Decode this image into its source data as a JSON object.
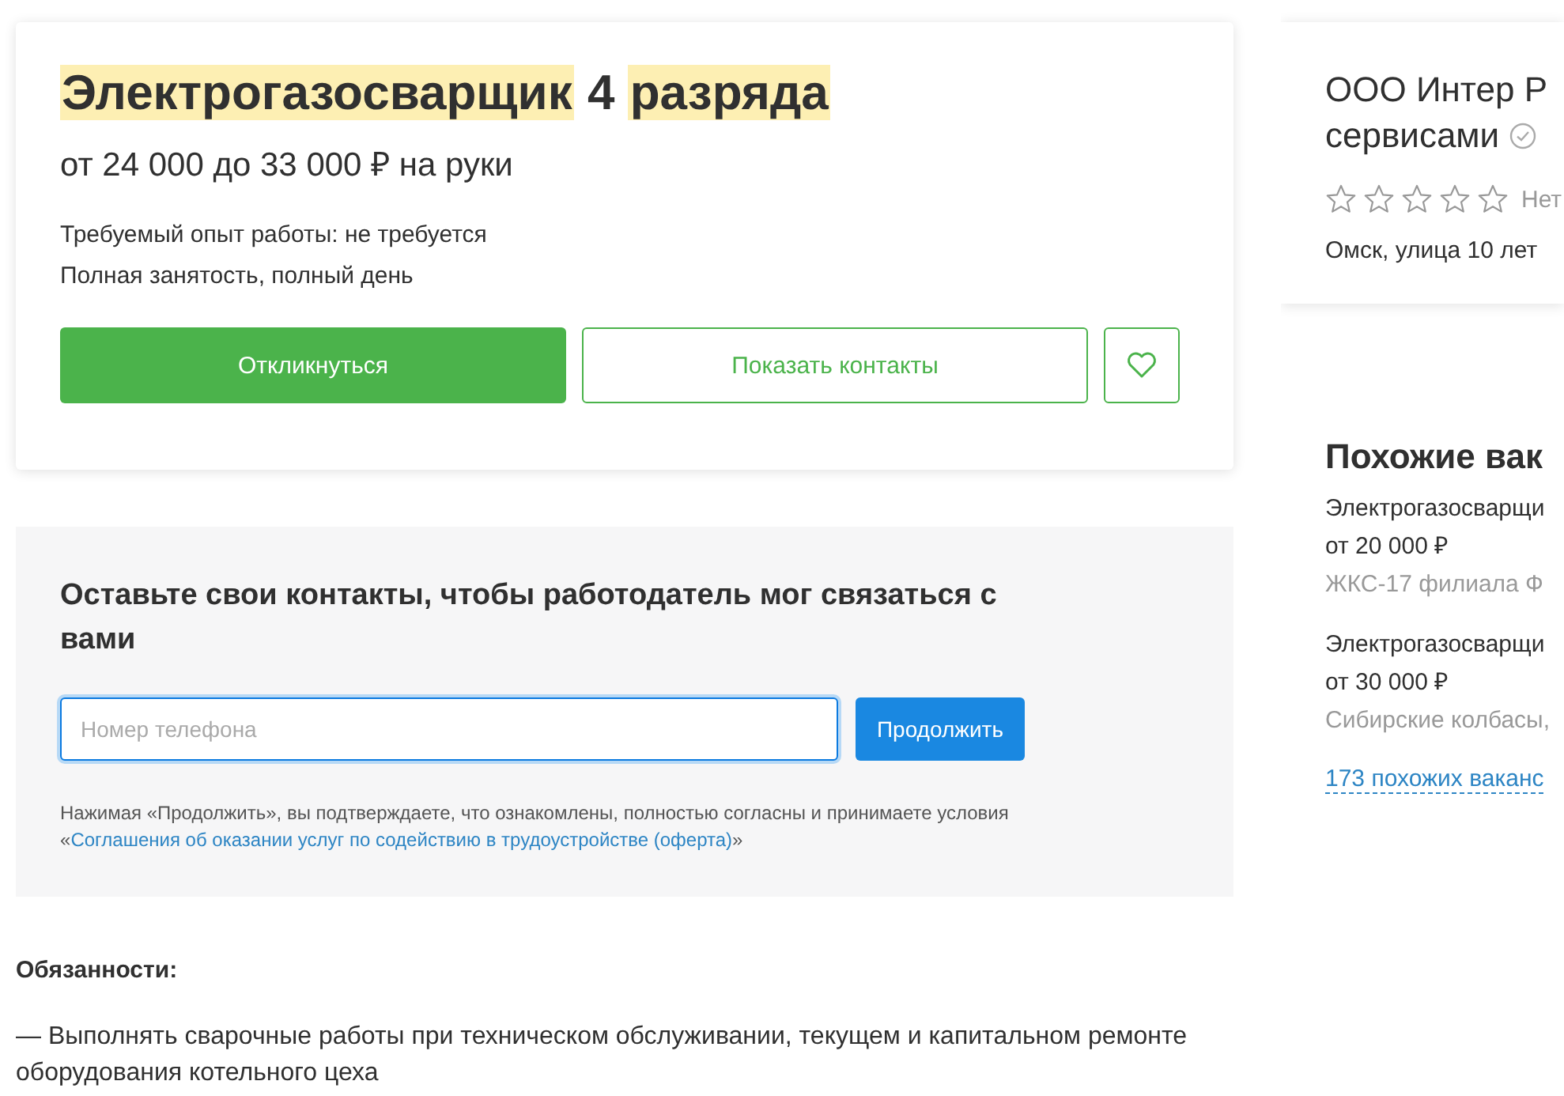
{
  "vacancy": {
    "title": [
      {
        "text": "Электрогазосварщик",
        "highlighted": true
      },
      {
        "text": "4",
        "highlighted": false
      },
      {
        "text": "разряда",
        "highlighted": true
      }
    ],
    "salary": "от 24 000 до 33 000 ₽ на руки",
    "details": [
      "Требуемый опыт работы: не требуется",
      "Полная занятость, полный день"
    ],
    "respond_button": "Откликнуться",
    "contacts_button": "Показать контакты",
    "favorite": {
      "selected": false
    }
  },
  "contact_form": {
    "heading": "Оставьте свои контакты, чтобы работодатель мог связаться с вами",
    "phone": {
      "placeholder": "Номер телефона"
    },
    "continue_button": "Продолжить",
    "terms_prefix": "Нажимая «Продолжить», вы подтверждаете, что ознакомлены, полностью согласны и принимаете условия «",
    "terms_link": "Соглашения об оказании услуг по содействию в трудоустройстве (оферта)",
    "terms_suffix": "»"
  },
  "description": {
    "heading": "Обязанности:",
    "items": [
      "— Выполнять сварочные работы при техническом обслуживании, текущем и капитальном ремонте оборудования котельного цеха"
    ]
  },
  "employer": {
    "name_lines": [
      "ООО Интер Р",
      "сервисами"
    ],
    "verified": true,
    "stars": 0,
    "reviews": "Нет",
    "address": "Омск, улица 10 лет"
  },
  "similar": {
    "heading": "Похожие вак",
    "items": [
      {
        "title": "Электрогазосварщи",
        "salary": "от 20 000 ₽",
        "company": "ЖКС-17 филиала Ф"
      },
      {
        "title": "Электрогазосварщи",
        "salary": "от 30 000 ₽",
        "company": "Сибирские колбасы,"
      }
    ],
    "more_link": "173 похожих ваканс"
  }
}
